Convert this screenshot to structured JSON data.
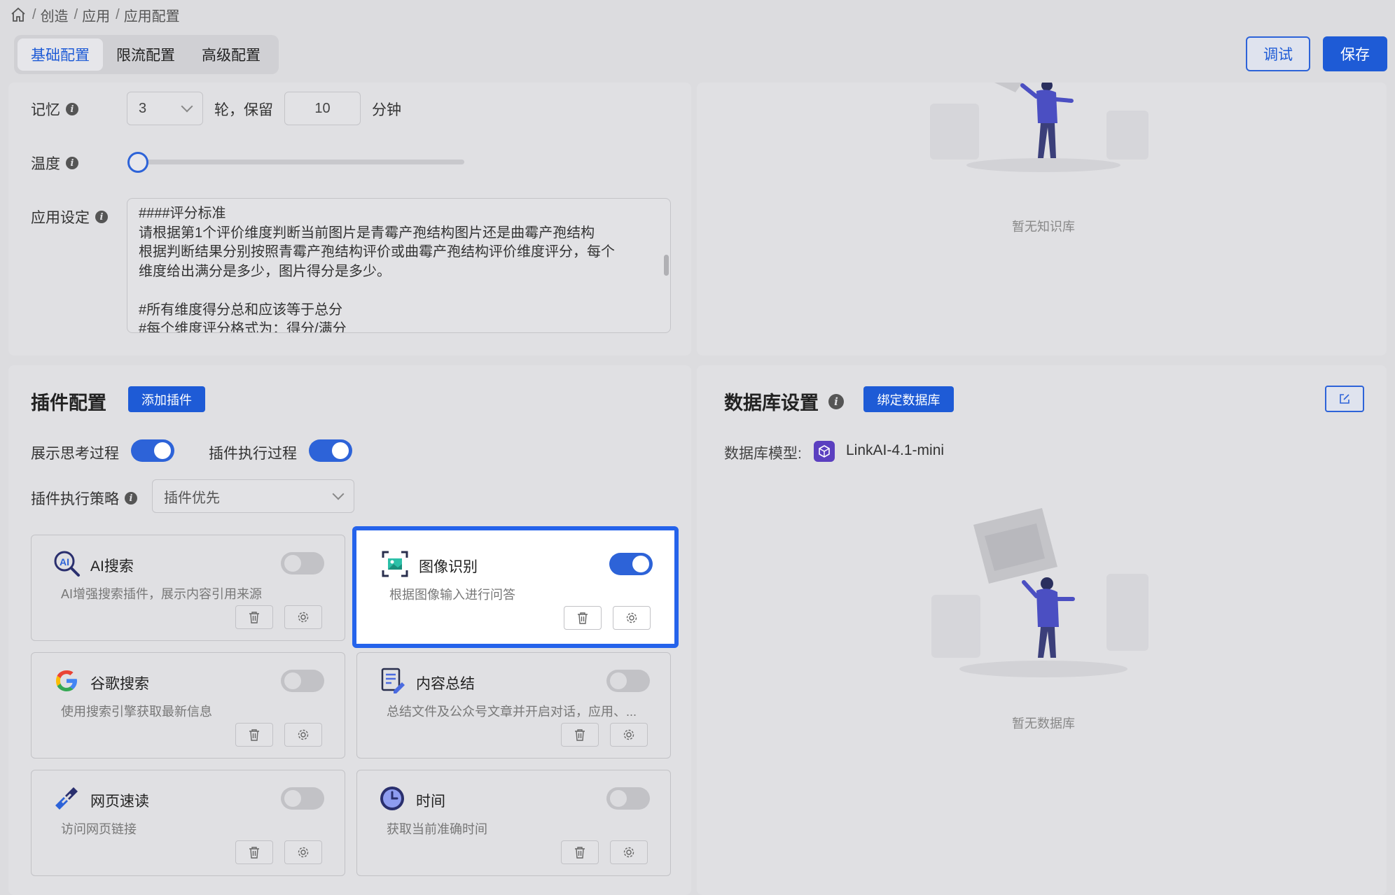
{
  "breadcrumb": {
    "items": [
      "创造",
      "应用",
      "应用配置"
    ]
  },
  "tabs": [
    {
      "label": "基础配置",
      "active": true
    },
    {
      "label": "限流配置",
      "active": false
    },
    {
      "label": "高级配置",
      "active": false
    }
  ],
  "actions": {
    "debug_label": "调试",
    "save_label": "保存"
  },
  "basic": {
    "memory_label": "记忆",
    "memory_rounds": "3",
    "rounds_text": "轮，保留",
    "retain_minutes": "10",
    "minutes_text": "分钟",
    "temperature_label": "温度",
    "temperature_value": 0,
    "app_setting_label": "应用设定",
    "app_setting_lines": [
      "####评分标准",
      "请根据第1个评价维度判断当前图片是青霉产孢结构图片还是曲霉产孢结构",
      "根据判断结果分别按照青霉产孢结构评价或曲霉产孢结构评价维度评分，每个",
      "维度给出满分是多少，图片得分是多少。",
      "",
      "#所有维度得分总和应该等于总分",
      "#每个维度评分格式为：得分/满分"
    ]
  },
  "knowledge": {
    "empty_text": "暂无知识库"
  },
  "plugins": {
    "title": "插件配置",
    "add_label": "添加插件",
    "show_thinking_label": "展示思考过程",
    "show_thinking_on": true,
    "show_exec_label": "插件执行过程",
    "show_exec_on": true,
    "policy_label": "插件执行策略",
    "policy_value": "插件优先",
    "items": [
      {
        "name": "AI搜索",
        "desc": "AI增强搜索插件，展示内容引用来源",
        "enabled": false,
        "icon": "ai-search-icon"
      },
      {
        "name": "图像识别",
        "desc": "根据图像输入进行问答",
        "enabled": true,
        "icon": "image-recognition-icon"
      },
      {
        "name": "谷歌搜索",
        "desc": "使用搜索引擎获取最新信息",
        "enabled": false,
        "icon": "google-icon"
      },
      {
        "name": "内容总结",
        "desc": "总结文件及公众号文章并开启对话，应用、...",
        "enabled": false,
        "icon": "summary-icon"
      },
      {
        "name": "网页速读",
        "desc": "访问网页链接",
        "enabled": false,
        "icon": "link-icon"
      },
      {
        "name": "时间",
        "desc": "获取当前准确时间",
        "enabled": false,
        "icon": "clock-icon"
      }
    ]
  },
  "database": {
    "title": "数据库设置",
    "bind_label": "绑定数据库",
    "model_label": "数据库模型:",
    "model_value": "LinkAI-4.1-mini",
    "empty_text": "暂无数据库"
  },
  "colors": {
    "accent": "#1e5bd6",
    "selected_border": "#2563eb",
    "background": "#dcdcdf"
  }
}
